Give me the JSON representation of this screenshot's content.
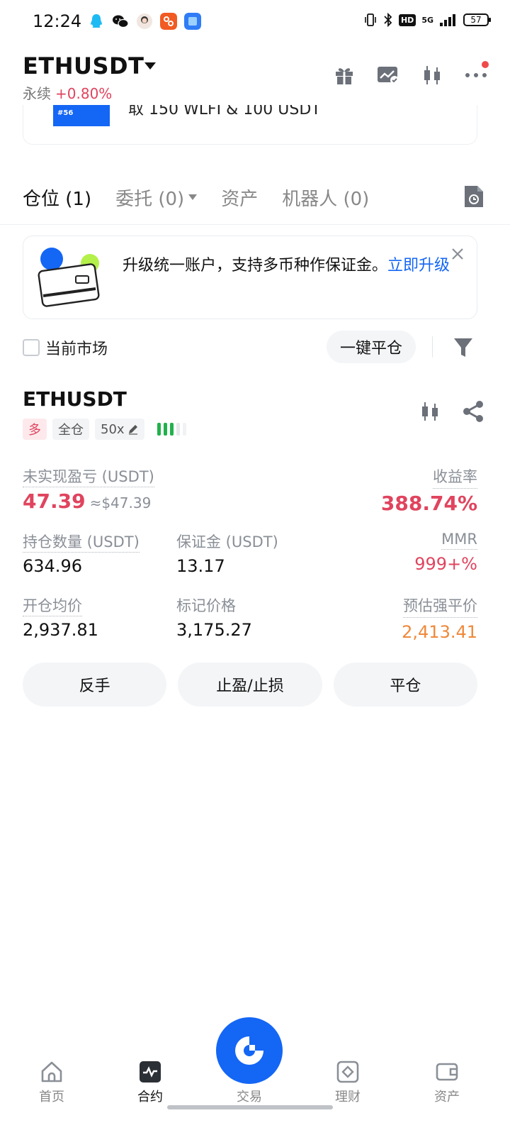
{
  "status_bar": {
    "time": "12:24",
    "network": "5G",
    "battery": "57",
    "hd_label": "HD"
  },
  "header": {
    "pair": "ETHUSDT",
    "contract_type": "永续",
    "change": "+0.80%"
  },
  "promo": {
    "text": "取 150 WLFI & 100 USDT",
    "tag": "#56"
  },
  "tabs": [
    {
      "label": "仓位 (1)",
      "active": true
    },
    {
      "label": "委托 (0)",
      "active": false
    },
    {
      "label": "资产",
      "active": false
    },
    {
      "label": "机器人 (0)",
      "active": false
    }
  ],
  "upgrade": {
    "text": "升级统一账户，支持多币种作保证金。",
    "link": "立即升级"
  },
  "filter": {
    "current_market": "当前市场",
    "close_all": "一键平仓"
  },
  "position": {
    "symbol": "ETHUSDT",
    "side": "多",
    "margin_mode": "全仓",
    "leverage": "50x",
    "unrealized_pnl_label": "未实现盈亏 (USDT)",
    "unrealized_pnl": "47.39",
    "unrealized_pnl_usd": "≈$47.39",
    "roe_label": "收益率",
    "roe": "388.74%",
    "size_label": "持仓数量 (USDT)",
    "size": "634.96",
    "margin_label": "保证金 (USDT)",
    "margin": "13.17",
    "mmr_label": "MMR",
    "mmr": "999+%",
    "entry_label": "开仓均价",
    "entry": "2,937.81",
    "mark_label": "标记价格",
    "mark": "3,175.27",
    "liq_label": "预估强平价",
    "liq": "2,413.41"
  },
  "actions": {
    "reverse": "反手",
    "tpsl": "止盈/止损",
    "close": "平仓"
  },
  "nav": {
    "home": "首页",
    "futures": "合约",
    "trade": "交易",
    "earn": "理财",
    "assets": "资产"
  },
  "colors": {
    "accent": "#1466f5",
    "up": "#e0445e",
    "warning": "#f0883a",
    "leverage_green": "#22b14c"
  }
}
